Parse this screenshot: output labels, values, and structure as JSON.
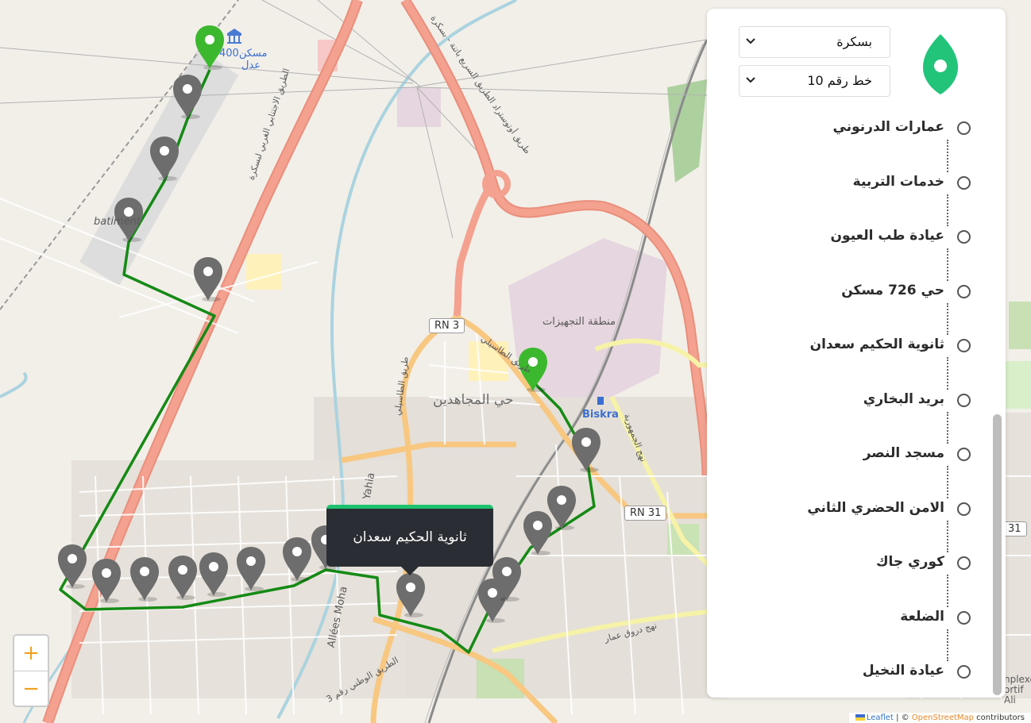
{
  "map": {
    "labels": {
      "district": "حي المجاهدين",
      "zone": "منطقة التجهيزات",
      "station": "Biskra",
      "batiment": "batiment",
      "poi": "400مسكن عدل",
      "road_yahia": "Yahia",
      "road_allees": "Allées Moha",
      "road_tassili": "طريق الطاسيلي",
      "road_rn3_long": "الطريق الوطني رقم 3",
      "road_jomhouria": "نهج الجمهورية",
      "road_omar": "نهج دروق عمار",
      "road_highway": "طريق أوتوستراد الطريق السريع باتنة - بسكرة",
      "road_bypass": "الطريق الاجتنابي الغربي لبسكرة",
      "edge_text": "nplexe ortif Ali"
    },
    "shields": {
      "rn3": "RN 3",
      "rn31": "RN 31",
      "edge": "31"
    },
    "colors": {
      "route": "#158a15",
      "pin_grey": "#6d6d6d",
      "pin_green": "#3cb82e"
    }
  },
  "zoom": {
    "in_label": "+",
    "out_label": "−"
  },
  "tooltip": {
    "text": "ثانوية الحكيم سعدان"
  },
  "panel": {
    "city_select": {
      "value": "بسكرة"
    },
    "line_select": {
      "value": "خط رقم 10"
    },
    "logo_icon": "location-pin-icon",
    "accent": "#22c47a",
    "stops": [
      {
        "name": "عمارات الدرنوني"
      },
      {
        "name": "خدمات التربية"
      },
      {
        "name": "عيادة طب العيون"
      },
      {
        "name": "حي 726 مسكن"
      },
      {
        "name": "ثانوية الحكيم سعدان"
      },
      {
        "name": "بريد البخاري"
      },
      {
        "name": "مسجد النصر"
      },
      {
        "name": "الامن الحضري الثاني"
      },
      {
        "name": "كوري جاك"
      },
      {
        "name": "الضلعة"
      },
      {
        "name": "عيادة النخيل"
      }
    ]
  },
  "attribution": {
    "leaflet": "Leaflet",
    "sep": " | © ",
    "osm": "OpenStreetMap",
    "rest": " contributors"
  }
}
